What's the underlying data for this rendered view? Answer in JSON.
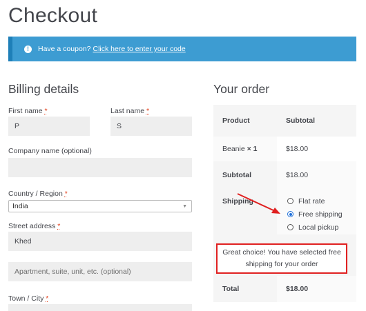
{
  "page": {
    "title": "Checkout"
  },
  "coupon": {
    "prompt": "Have a coupon?",
    "link": "Click here to enter your code"
  },
  "billing": {
    "title": "Billing details",
    "first_name": {
      "label": "First name",
      "value": "P"
    },
    "last_name": {
      "label": "Last name",
      "value": "S"
    },
    "company": {
      "label": "Company name (optional)",
      "value": ""
    },
    "country": {
      "label": "Country / Region",
      "value": "India"
    },
    "street": {
      "label": "Street address",
      "value": "Khed",
      "apartment_placeholder": "Apartment, suite, unit, etc. (optional)"
    },
    "town": {
      "label": "Town / City"
    },
    "required_mark": "*"
  },
  "order": {
    "title": "Your order",
    "headers": {
      "product": "Product",
      "subtotal": "Subtotal"
    },
    "item": {
      "name": "Beanie",
      "qty": "× 1",
      "price": "$18.00"
    },
    "subtotal": {
      "label": "Subtotal",
      "value": "$18.00"
    },
    "shipping": {
      "label": "Shipping",
      "options": [
        "Flat rate",
        "Free shipping",
        "Local pickup"
      ],
      "selected": "Free shipping"
    },
    "note": "Great choice! You have selected free shipping for your order",
    "total": {
      "label": "Total",
      "value": "$18.00"
    }
  },
  "colors": {
    "accent": "#3d9cd2",
    "required": "#e2401c",
    "highlight_box": "#e02020",
    "arrow": "#e02020"
  }
}
